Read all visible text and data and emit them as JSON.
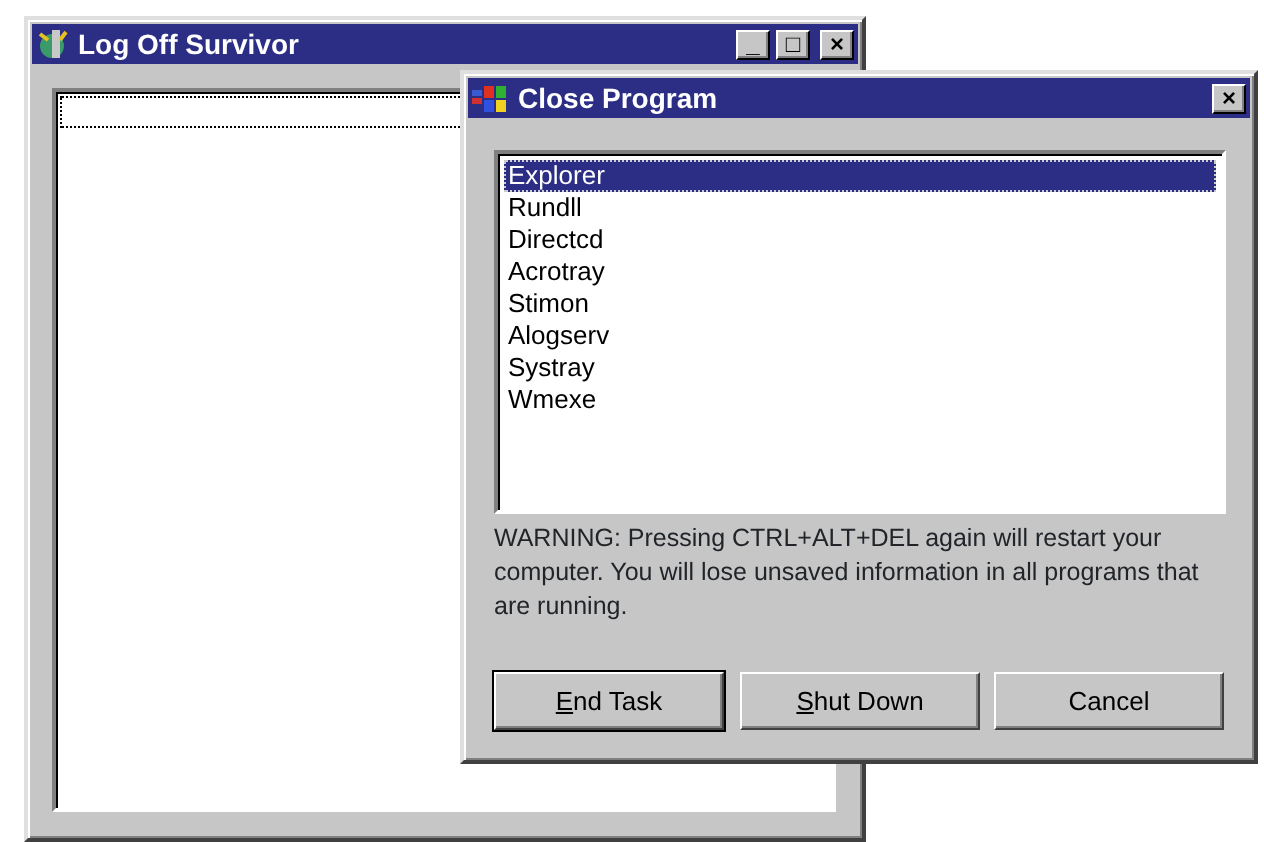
{
  "back_window": {
    "title": "Log Off Survivor",
    "controls": [
      "_",
      "□",
      "×"
    ]
  },
  "dialog": {
    "title": "Close Program",
    "close": "×",
    "programs": [
      {
        "name": "Explorer",
        "selected": true
      },
      {
        "name": "Rundll",
        "selected": false
      },
      {
        "name": "Directcd",
        "selected": false
      },
      {
        "name": "Acrotray",
        "selected": false
      },
      {
        "name": "Stimon",
        "selected": false
      },
      {
        "name": "Alogserv",
        "selected": false
      },
      {
        "name": "Systray",
        "selected": false
      },
      {
        "name": "Wmexe",
        "selected": false
      }
    ],
    "warning": "WARNING: Pressing CTRL+ALT+DEL again will restart your computer. You will lose unsaved information in all programs that are running.",
    "buttons": [
      {
        "accel": "E",
        "rest": "nd Task",
        "default": true
      },
      {
        "accel": "S",
        "rest": "hut Down",
        "default": false
      },
      {
        "rest": "Cancel",
        "default": false
      }
    ]
  }
}
